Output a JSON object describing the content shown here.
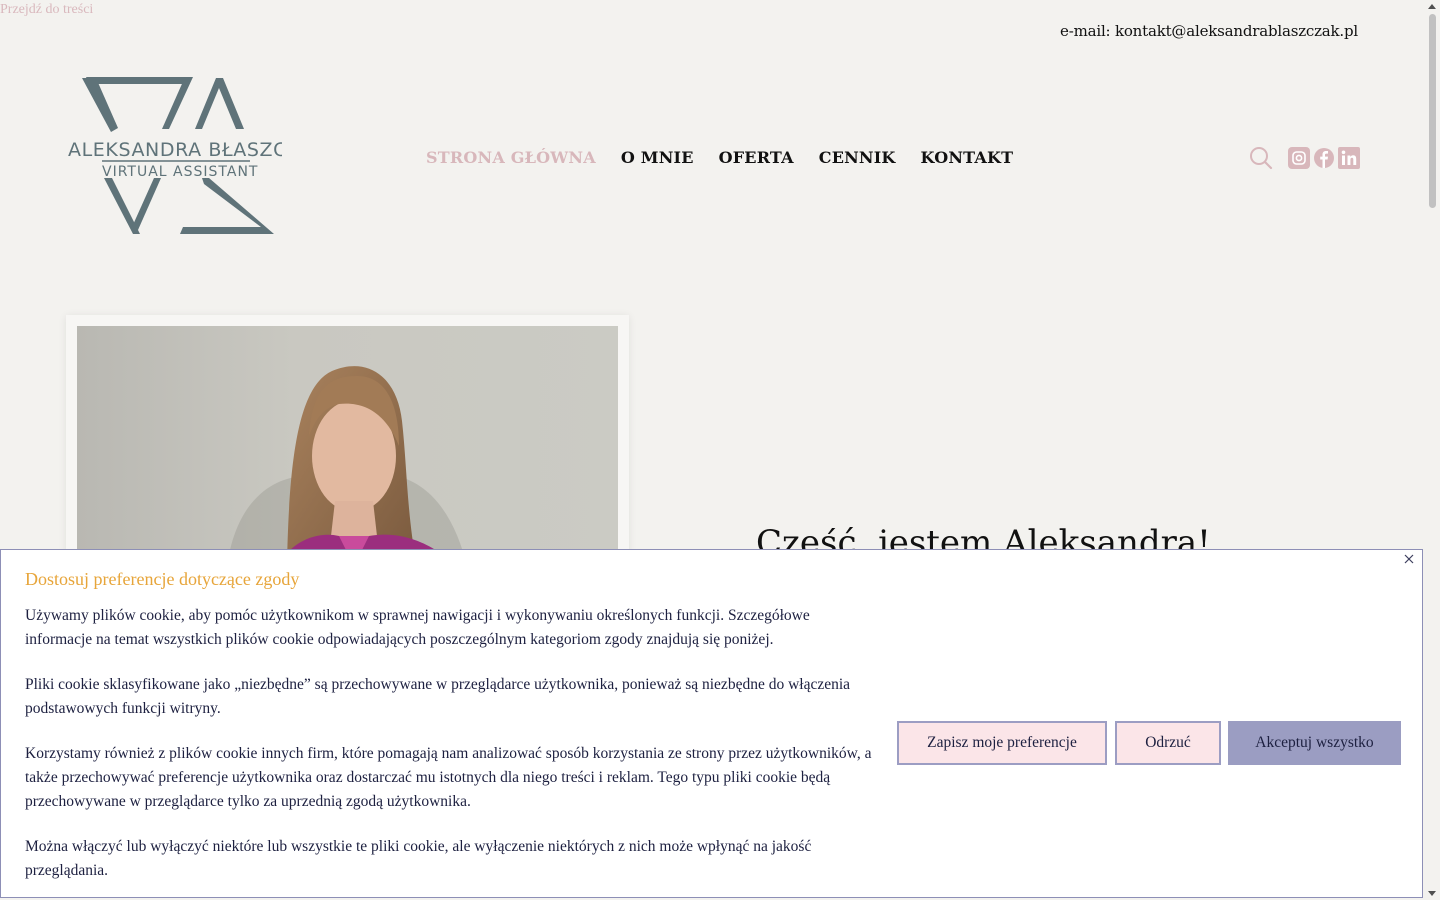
{
  "skip_link": "Przejdź do treści",
  "topbar": {
    "email": "e-mail: kontakt@aleksandrablaszczak.pl"
  },
  "logo": {
    "name": "Aleksandra Błaszczak",
    "tagline": "Virtual Assistant",
    "color": "#5f7379"
  },
  "nav": [
    {
      "label": "STRONA GŁÓWNA",
      "active": true
    },
    {
      "label": "O MNIE",
      "active": false
    },
    {
      "label": "OFERTA",
      "active": false
    },
    {
      "label": "CENNIK",
      "active": false
    },
    {
      "label": "KONTAKT",
      "active": false
    }
  ],
  "header_icons": [
    "search-icon",
    "instagram-icon",
    "facebook-icon",
    "linkedin-icon"
  ],
  "hero": {
    "title": "Cześć, jestem Aleksandra!"
  },
  "cookie": {
    "title": "Dostosuj preferencje dotyczące zgody",
    "paragraphs": [
      "Używamy plików cookie, aby pomóc użytkownikom w sprawnej nawigacji i wykonywaniu określonych funkcji. Szczegółowe informacje na temat wszystkich plików cookie odpowiadających poszczególnym kategoriom zgody znajdują się poniżej.",
      "Pliki cookie sklasyfikowane jako „niezbędne” są przechowywane w przeglądarce użytkownika, ponieważ są niezbędne do włączenia podstawowych funkcji witryny.",
      "Korzystamy również z plików cookie innych firm, które pomagają nam analizować sposób korzystania ze strony przez użytkowników, a także przechowywać preferencje użytkownika oraz dostarczać mu istotnych dla niego treści i reklam. Tego typu pliki cookie będą przechowywane w przeglądarce tylko za uprzednią zgodą użytkownika.",
      "Można włączyć lub wyłączyć niektóre lub wszystkie te pliki cookie, ale wyłączenie niektórych z nich może wpłynąć na jakość przeglądania."
    ],
    "buttons": {
      "save": "Zapisz moje preferencje",
      "reject": "Odrzuć",
      "accept": "Akceptuj wszystko"
    }
  },
  "colors": {
    "accent_pink": "#d8b7bb",
    "logo_teal": "#5f7379",
    "cookie_title": "#e7a53a",
    "button_accept": "#9b9dc2",
    "button_light": "#fbe5e8",
    "background": "#f3f2ef"
  }
}
